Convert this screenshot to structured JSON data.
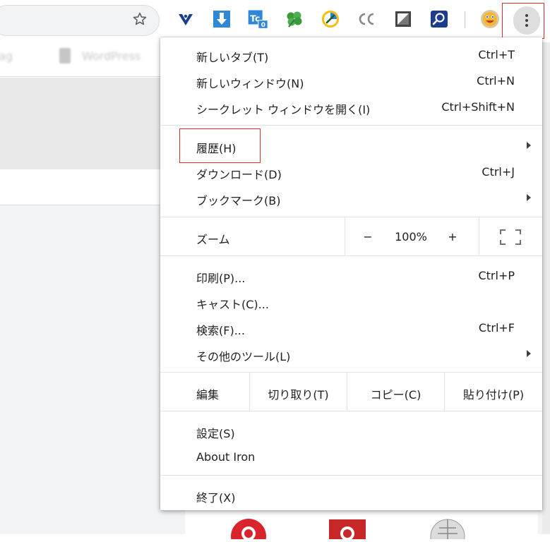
{
  "toolbar": {
    "icons": [
      "star-icon",
      "vivaldi-icon",
      "download-icon",
      "tc-icon",
      "clover-icon",
      "speed-icon",
      "cc-icon",
      "window-icon",
      "search-icon",
      "avatar-icon",
      "more-vert-icon"
    ],
    "badge": "0",
    "cc_label": "CC"
  },
  "bookmarks": {
    "item1": "ag",
    "item2": "WordPress"
  },
  "menu": {
    "new_tab": {
      "label": "新しいタブ(T)",
      "shortcut": "Ctrl+T"
    },
    "new_window": {
      "label": "新しいウィンドウ(N)",
      "shortcut": "Ctrl+N"
    },
    "incognito": {
      "label": "シークレット ウィンドウを開く(I)",
      "shortcut": "Ctrl+Shift+N"
    },
    "history": {
      "label": "履歴(H)"
    },
    "downloads": {
      "label": "ダウンロード(D)",
      "shortcut": "Ctrl+J"
    },
    "bookmarks": {
      "label": "ブックマーク(B)"
    },
    "zoom": {
      "label": "ズーム",
      "minus": "−",
      "value": "100%",
      "plus": "+"
    },
    "print": {
      "label": "印刷(P)...",
      "shortcut": "Ctrl+P"
    },
    "cast": {
      "label": "キャスト(C)..."
    },
    "find": {
      "label": "検索(F)...",
      "shortcut": "Ctrl+F"
    },
    "more_tools": {
      "label": "その他のツール(L)"
    },
    "edit": {
      "label": "編集",
      "cut": "切り取り(T)",
      "copy": "コピー(C)",
      "paste": "貼り付け(P)"
    },
    "settings": {
      "label": "設定(S)"
    },
    "about": {
      "label": "About Iron"
    },
    "exit": {
      "label": "終了(X)"
    }
  },
  "colors": {
    "highlight": "#d32f2f",
    "menu_bg": "#ffffff",
    "page_gray": "#e8e8e8"
  }
}
